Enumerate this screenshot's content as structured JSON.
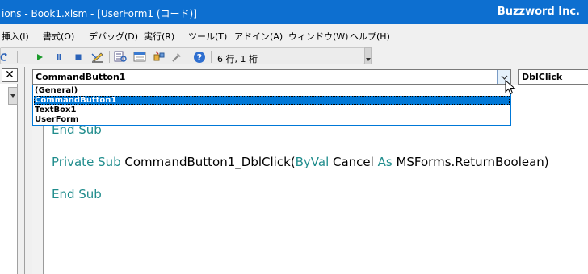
{
  "window": {
    "title": "ions - Book1.xlsm - [UserForm1 (コード)]",
    "brand": "Buzzword Inc."
  },
  "menu": {
    "items": [
      "挿入(I)",
      "書式(O)",
      "デバッグ(D)",
      "実行(R)",
      "ツール(T)",
      "アドイン(A)",
      "ウィンドウ(W)",
      "ヘルプ(H)"
    ]
  },
  "toolbar": {
    "status": "6 行, 1 桁"
  },
  "code_window": {
    "object_combo_value": "CommandButton1",
    "procedure_combo_value": "DblClick",
    "object_list": [
      {
        "label": "(General)",
        "selected": false
      },
      {
        "label": "CommandButton1",
        "selected": true
      },
      {
        "label": "TextBox1",
        "selected": false
      },
      {
        "label": "UserForm",
        "selected": false
      }
    ],
    "code": {
      "line1": {
        "kw": "End Sub"
      },
      "line2": {
        "kw1": "Private Sub",
        "text1": " CommandButton1_DblClick(",
        "kw2": "ByVal",
        "text2": " Cancel ",
        "kw3": "As",
        "text3": " MSForms.ReturnBoolean)"
      },
      "line3": {
        "kw": "End Sub"
      }
    }
  },
  "left_pane": {
    "close_label": "✕"
  },
  "colors": {
    "titlebar": "#0d6fd0",
    "keyword": "#1f8c8c",
    "selection": "#0078d7"
  }
}
